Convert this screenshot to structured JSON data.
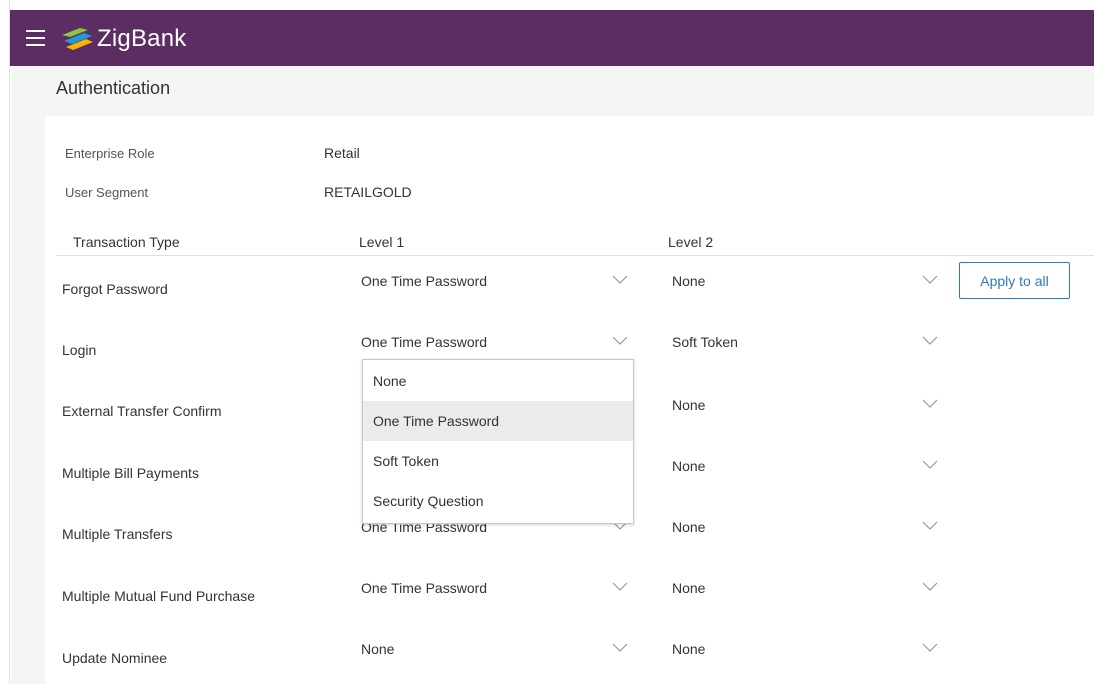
{
  "app": {
    "name": "ZigBank"
  },
  "page": {
    "title": "Authentication"
  },
  "info": {
    "enterprise_role_label": "Enterprise Role",
    "enterprise_role_value": "Retail",
    "user_segment_label": "User Segment",
    "user_segment_value": "RETAILGOLD"
  },
  "columns": {
    "transaction_type": "Transaction Type",
    "level1": "Level 1",
    "level2": "Level 2"
  },
  "rows": [
    {
      "label": "Forgot Password",
      "level1": "One Time Password",
      "level2": "None"
    },
    {
      "label": "Login",
      "level1": "One Time Password",
      "level2": "Soft Token"
    },
    {
      "label": "External Transfer Confirm",
      "level1": "",
      "level2": "None"
    },
    {
      "label": "Multiple Bill Payments",
      "level1": "",
      "level2": "None"
    },
    {
      "label": "Multiple Transfers",
      "level1": "One Time Password",
      "level2": "None"
    },
    {
      "label": "Multiple Mutual Fund Purchase",
      "level1": "One Time Password",
      "level2": "None"
    },
    {
      "label": "Update Nominee",
      "level1": "None",
      "level2": "None"
    }
  ],
  "apply_button": "Apply to all",
  "dropdown": {
    "options": [
      "None",
      "One Time Password",
      "Soft Token",
      "Security Question"
    ],
    "selected": "One Time Password"
  },
  "colors": {
    "header_bg": "#5c2d62",
    "accent": "#2c7ab7",
    "logo_green": "#8dc63f",
    "logo_blue": "#1f9bd7",
    "logo_yellow": "#f7b500"
  },
  "icons": {
    "menu": "hamburger-icon",
    "select": "chevron-down-icon",
    "logo": "zigbank-logo-icon"
  }
}
